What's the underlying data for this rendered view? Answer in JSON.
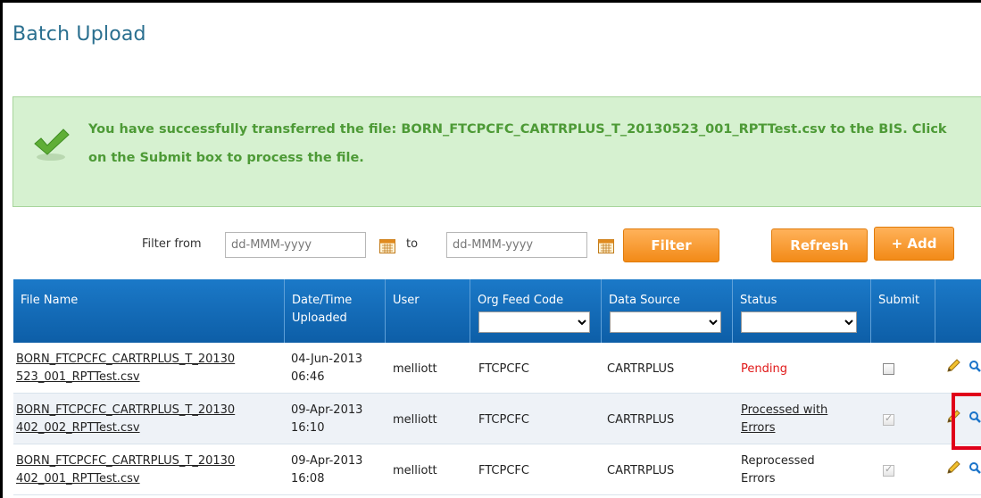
{
  "page": {
    "title": "Batch Upload"
  },
  "alert": {
    "message": "You have successfully transferred the file: BORN_FTCPCFC_CARTRPLUS_T_20130523_001_RPTTest.csv to the BIS. Click on the Submit box to process the file.",
    "icon": "checkmark-icon"
  },
  "filter": {
    "from_label": "Filter from",
    "from_placeholder": "dd-MMM-yyyy",
    "to_label": "to",
    "to_placeholder": "dd-MMM-yyyy",
    "filter_button": "Filter",
    "refresh_button": "Refresh",
    "add_button": "+ Add"
  },
  "table": {
    "columns": {
      "file_name": "File Name",
      "date": "Date/Time Uploaded",
      "user": "User",
      "org_feed_code": "Org Feed Code",
      "data_source": "Data Source",
      "status": "Status",
      "submit": "Submit"
    },
    "rows": [
      {
        "file_name": "BORN_FTCPCFC_CARTRPLUS_T_20130523_001_RPTTest.csv",
        "file_line1": "BORN_FTCPCFC_CARTRPLUS_T_20130",
        "file_line2": "523_001_RPTTest.csv",
        "date_line1": "04-Jun-2013",
        "date_line2": "06:46",
        "user": "melliott",
        "org_feed_code": "FTCPCFC",
        "data_source": "CARTRPLUS",
        "status_line1": "Pending",
        "status_line2": "",
        "submit_checked": false
      },
      {
        "file_name": "BORN_FTCPCFC_CARTRPLUS_T_20130402_002_RPTTest.csv",
        "file_line1": "BORN_FTCPCFC_CARTRPLUS_T_20130",
        "file_line2": "402_002_RPTTest.csv",
        "date_line1": "09-Apr-2013",
        "date_line2": "16:10",
        "user": "melliott",
        "org_feed_code": "FTCPCFC",
        "data_source": "CARTRPLUS",
        "status_line1": "Processed with",
        "status_line2": "Errors",
        "submit_checked": true
      },
      {
        "file_name": "BORN_FTCPCFC_CARTRPLUS_T_20130402_001_RPTTest.csv",
        "file_line1": "BORN_FTCPCFC_CARTRPLUS_T_20130",
        "file_line2": "402_001_RPTTest.csv",
        "date_line1": "09-Apr-2013",
        "date_line2": "16:08",
        "user": "melliott",
        "org_feed_code": "FTCPCFC",
        "data_source": "CARTRPLUS",
        "status_line1": "Reprocessed",
        "status_line2": "Errors",
        "submit_checked": true
      }
    ]
  },
  "colors": {
    "title": "#2a6f8f",
    "alert_bg": "#d6f1d0",
    "alert_text": "#4d9a36",
    "button": "#f28a17",
    "header": "#1b79c8",
    "pending": "#e01818",
    "highlight": "#e0001a"
  }
}
